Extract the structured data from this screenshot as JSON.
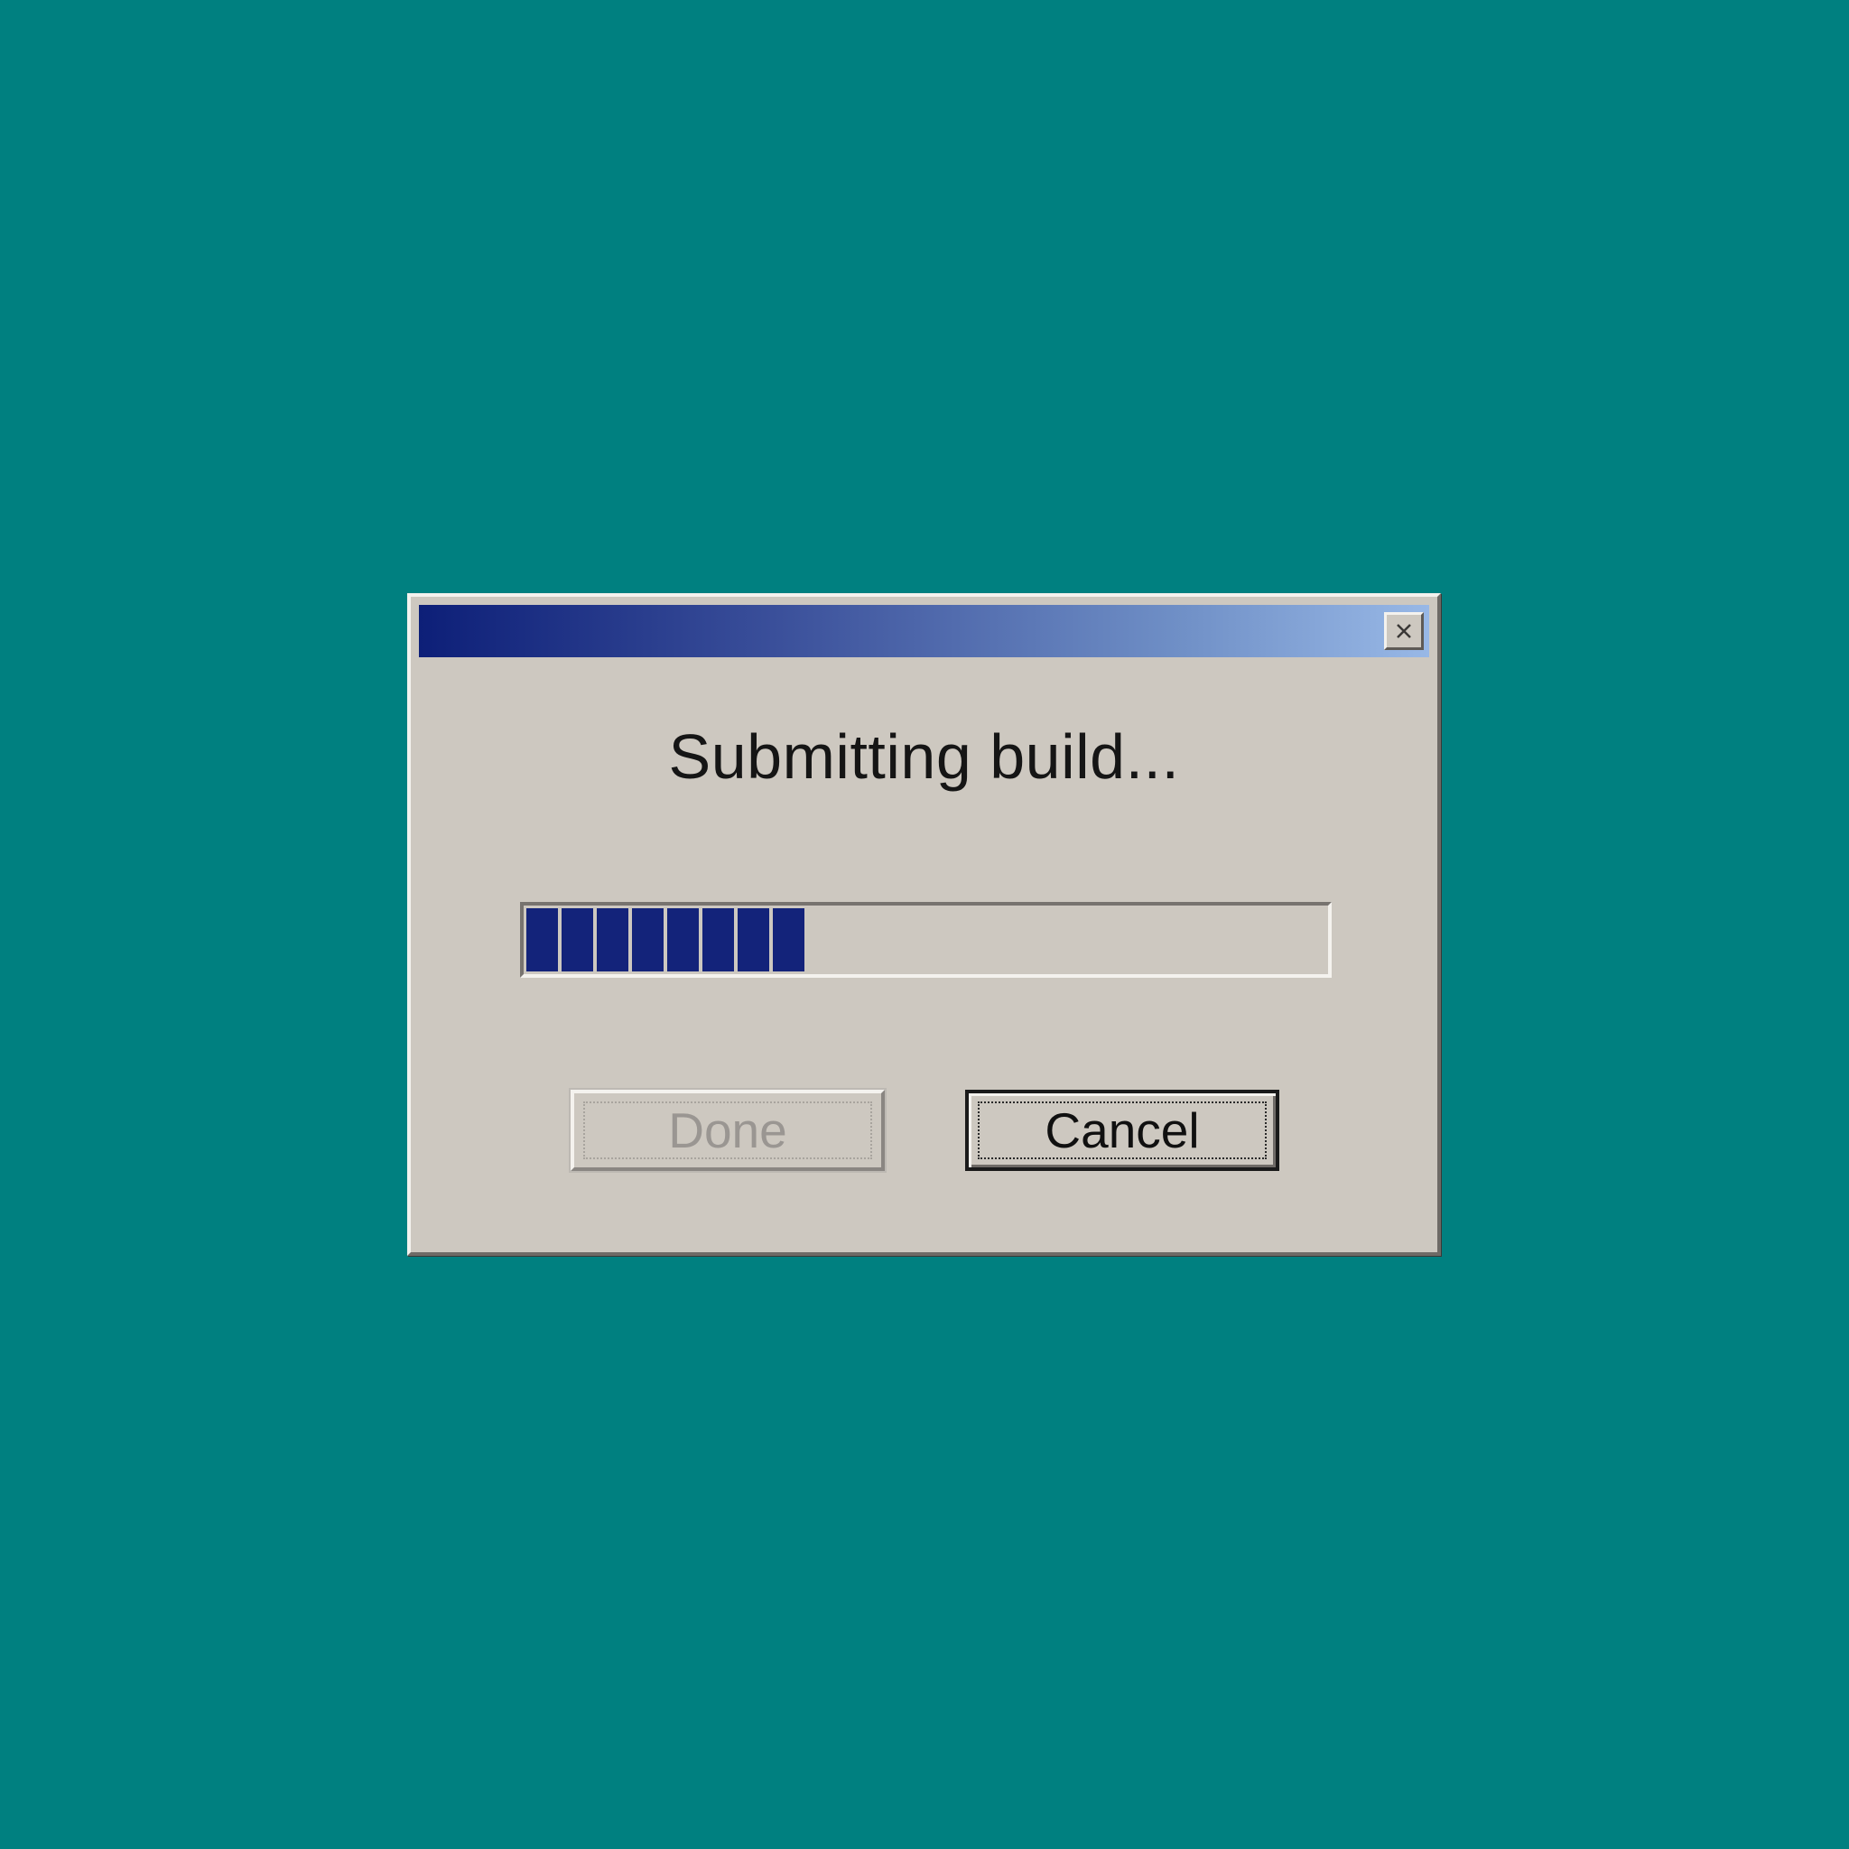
{
  "desktop": {
    "background_color": "#008080"
  },
  "dialog": {
    "title": "",
    "close_icon": "close-x-icon",
    "message": "Submitting build...",
    "progress": {
      "segments_filled": 8,
      "fraction": 0.35
    },
    "buttons": {
      "done_label": "Done",
      "done_enabled": false,
      "cancel_label": "Cancel",
      "cancel_enabled": true
    },
    "colors": {
      "title_gradient_start": "#0d1f78",
      "title_gradient_end": "#98b8e6",
      "progress_fill": "#13237a",
      "face": "#cdc8c0"
    }
  }
}
